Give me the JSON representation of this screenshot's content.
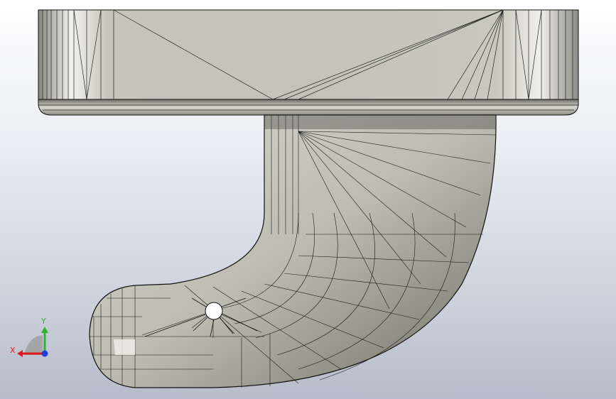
{
  "viewport": {
    "model": "bracket-with-curved-arm",
    "display_mode": "wireframe-shaded"
  },
  "triad": {
    "x_label": "X",
    "y_label": "Y",
    "x_color": "#e01b1b",
    "y_color": "#2fb12f",
    "z_color": "#1f3fd8"
  },
  "colors": {
    "face": "#c9c8bd",
    "face_light": "#e8e8e1",
    "edge": "#111111"
  }
}
